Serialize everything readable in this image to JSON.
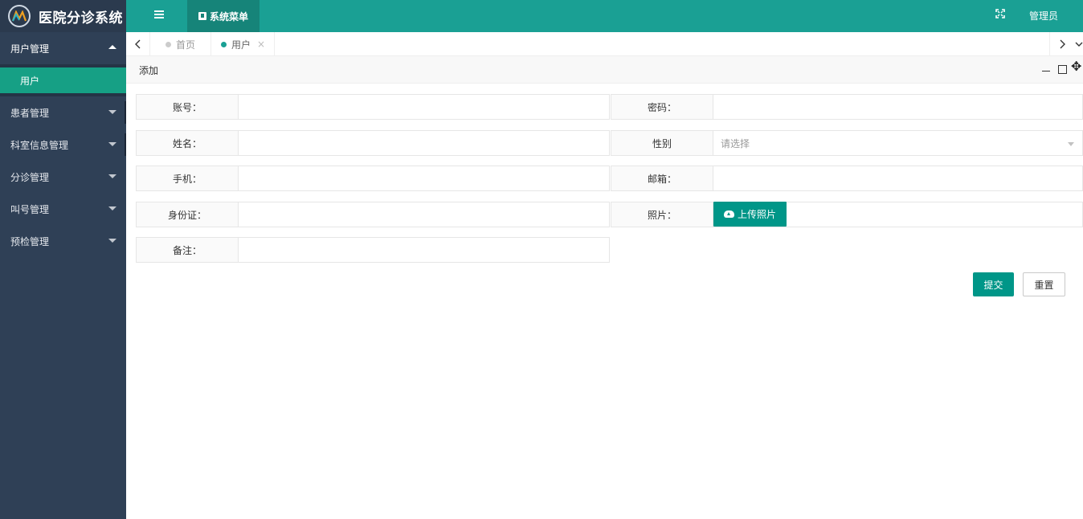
{
  "app": {
    "title": "医院分诊系统"
  },
  "sidebar": {
    "menus": [
      {
        "label": "用户管理",
        "expanded": true,
        "children": [
          {
            "label": "用户"
          }
        ]
      },
      {
        "label": "患者管理"
      },
      {
        "label": "科室信息管理"
      },
      {
        "label": "分诊管理"
      },
      {
        "label": "叫号管理"
      },
      {
        "label": "预检管理"
      }
    ]
  },
  "header": {
    "system_menu_label": "系统菜单",
    "user_name": "管理员"
  },
  "tabs": [
    {
      "label": "首页",
      "active": false
    },
    {
      "label": "用户",
      "active": true,
      "close": "×"
    }
  ],
  "panel": {
    "title": "添加"
  },
  "form": {
    "account_label": "账号：",
    "password_label": "密码：",
    "name_label": "姓名：",
    "gender_label": "性别",
    "gender_placeholder": "请选择",
    "phone_label": "手机：",
    "email_label": "邮箱：",
    "id_card_label": "身份证：",
    "photo_label": "照片：",
    "upload_label": "上传照片",
    "remark_label": "备注：",
    "submit_label": "提交",
    "reset_label": "重置"
  },
  "colors": {
    "sidebar": "#2f4056",
    "header": "#1aa094",
    "primary": "#009688"
  },
  "icons": [
    "menu-icon",
    "book-icon",
    "fullscreen-icon",
    "chevron-left-icon",
    "chevron-right-icon",
    "chevron-down-icon",
    "minimize-icon",
    "maximize-icon",
    "move-icon",
    "cloud-upload-icon"
  ]
}
